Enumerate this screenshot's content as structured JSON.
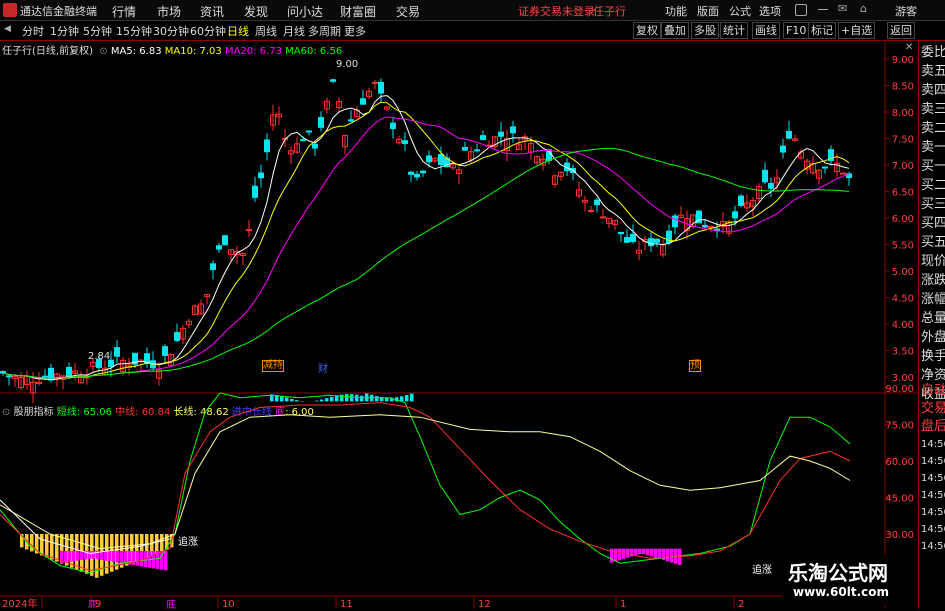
{
  "app": {
    "name": "通达信金融终端",
    "menu": [
      "行情",
      "市场",
      "资讯",
      "发现",
      "问小达",
      "财富圈",
      "交易"
    ],
    "login_status": "证券交易未登录",
    "stock_name": "任子行",
    "right_menu": [
      "功能",
      "版面",
      "公式",
      "选项"
    ],
    "guest": "游客"
  },
  "toolbar": {
    "periods": [
      "分时",
      "1分钟",
      "5分钟",
      "15分钟",
      "30分钟",
      "60分钟",
      "日线",
      "周线",
      "月线",
      "多周期",
      "更多"
    ],
    "active_period": "日线",
    "right_buttons": [
      "复权",
      "叠加",
      "多股",
      "统计",
      "画线",
      "F10",
      "标记",
      "+自选",
      "返回"
    ]
  },
  "main_chart": {
    "title": "任子行(日线,前复权)",
    "ma": [
      {
        "label": "MA5: 6.83",
        "color": "#ffffff"
      },
      {
        "label": "MA10: 7.03",
        "color": "#ffff00"
      },
      {
        "label": "MA20: 6.73",
        "color": "#ff00ff"
      },
      {
        "label": "MA60: 6.56",
        "color": "#00ff00"
      }
    ],
    "y_ticks": [
      "9.00",
      "8.50",
      "8.00",
      "7.50",
      "7.00",
      "6.50",
      "6.00",
      "5.50",
      "5.00",
      "4.50",
      "4.00",
      "3.50",
      "3.00"
    ],
    "high_label": "9.00",
    "low_label": "2.84",
    "markers": [
      {
        "text": "减持",
        "color": "#ff8c00"
      },
      {
        "text": "财",
        "color": "#4169e1"
      },
      {
        "text": "预",
        "color": "#ff8c00"
      }
    ]
  },
  "indicator": {
    "name": "股朋指标",
    "short_label": "短线: 65.06",
    "mid_label": "中线: 60.84",
    "long_label": "长线: 48.62",
    "extra_label": "进中长线",
    "bottom_label": "底",
    "bottom_value": ": 6.00",
    "y_ticks": [
      "90.00",
      "75.00",
      "60.00",
      "45.00",
      "30.00"
    ],
    "chase_label_1": "追涨",
    "chase_label_2": "追涨",
    "bottom_mark_1": "底",
    "bottom_mark_2": "底"
  },
  "x_axis": [
    "2024年",
    "9",
    "10",
    "11",
    "12",
    "1",
    "2"
  ],
  "side_panel": {
    "items": [
      "委比",
      "卖五",
      "卖四",
      "卖三",
      "卖二",
      "卖一",
      "买一",
      "买二",
      "买三",
      "买四",
      "买五",
      "现价",
      "涨跌",
      "涨幅",
      "总量",
      "外盘",
      "换手",
      "净资",
      "收益",
      "自动",
      "交易",
      "盘后"
    ],
    "times": [
      "14:56",
      "14:56",
      "14:56",
      "14:56",
      "14:56",
      "14:56",
      "14:56"
    ]
  },
  "watermark": {
    "title": "乐淘公式网",
    "url": "www.60lt.com"
  }
}
